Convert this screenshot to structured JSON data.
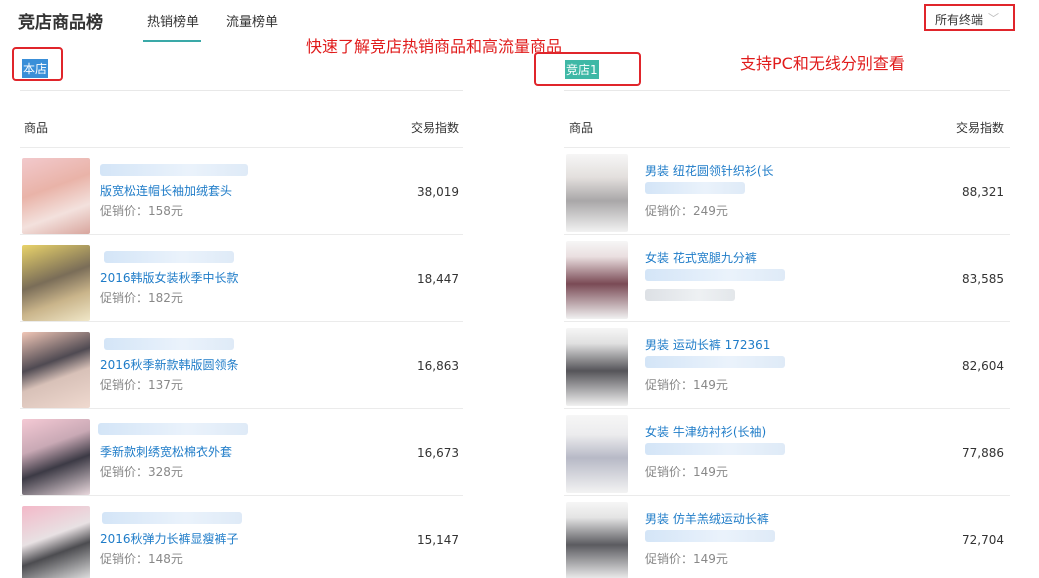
{
  "header": {
    "title": "竞店商品榜",
    "tabs": [
      {
        "label": "热销榜单",
        "active": true
      },
      {
        "label": "流量榜单",
        "active": false
      }
    ],
    "terminal_select": {
      "value": "所有终端"
    }
  },
  "annotations": {
    "left": "快速了解竞店热销商品和高流量商品",
    "right": "支持PC和无线分别查看"
  },
  "colors": {
    "accent": "#3aa9a8",
    "link": "#1f7cc8",
    "annotation": "#e01b1b",
    "own_tag": "#3a8fd8",
    "comp_tag": "#3fb8a6"
  },
  "own_shop": {
    "tag": "本店",
    "col_product": "商品",
    "col_index": "交易指数",
    "price_label": "促销价：",
    "items": [
      {
        "title": "版宽松连帽长袖加绒套头",
        "price": "158元",
        "index": "38,019"
      },
      {
        "title": "2016韩版女装秋季中长款",
        "price": "182元",
        "index": "18,447"
      },
      {
        "title": "2016秋季新款韩版圆领条",
        "price": "137元",
        "index": "16,863"
      },
      {
        "title": "季新款刺绣宽松棉衣外套",
        "price": "328元",
        "index": "16,673"
      },
      {
        "title": "2016秋弹力长裤显瘦裤子",
        "price": "148元",
        "index": "15,147"
      }
    ]
  },
  "competitor_shop": {
    "tag": "竞店1",
    "col_product": "商品",
    "col_index": "交易指数",
    "price_label": "促销价：",
    "items": [
      {
        "title": "男装 纽花圆领针织衫(长",
        "price": "249元",
        "index": "88,321"
      },
      {
        "title": "女装 花式宽腿九分裤",
        "price": "",
        "index": "83,585"
      },
      {
        "title": "男装 运动长裤 172361",
        "price": "149元",
        "index": "82,604"
      },
      {
        "title": "女装 牛津纺衬衫(长袖)",
        "price": "149元",
        "index": "77,886"
      },
      {
        "title": "男装 仿羊羔绒运动长裤",
        "price": "149元",
        "index": "72,704"
      }
    ]
  }
}
